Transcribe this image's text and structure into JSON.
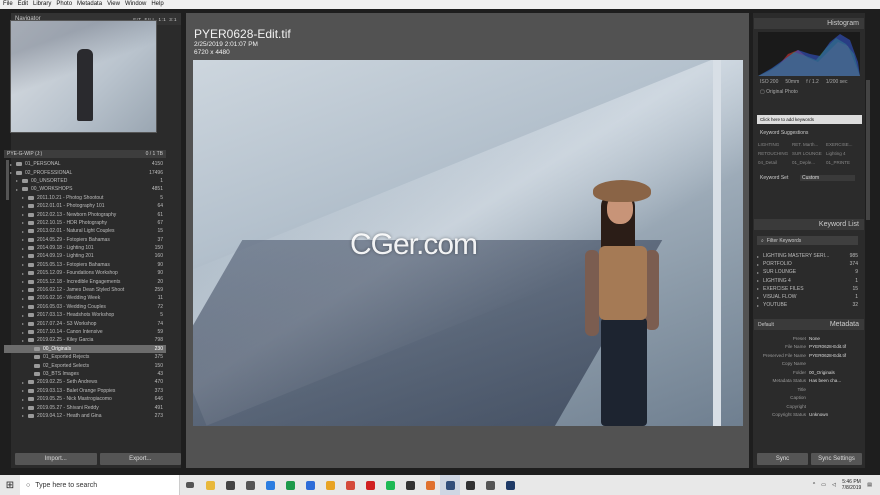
{
  "menu": [
    "File",
    "Edit",
    "Library",
    "Photo",
    "Metadata",
    "View",
    "Window",
    "Help"
  ],
  "navigator": {
    "title": "Navigator",
    "modes": [
      "FIT",
      "FILL",
      "1:1",
      "3:1"
    ]
  },
  "collections": {
    "header": "PYE-G-WIP (J:)",
    "header_count": "0 / 1 TB",
    "items": [
      {
        "name": "01_PERSONAL",
        "count": "4150",
        "indent": 1
      },
      {
        "name": "02_PROFESSIONAL",
        "count": "17496",
        "indent": 1
      },
      {
        "name": "00_UNSORTED",
        "count": "1",
        "indent": 2
      },
      {
        "name": "00_WORKSHOPS",
        "count": "4851",
        "indent": 2
      },
      {
        "name": "2011.10.21 - Photog Shootout",
        "count": "5",
        "indent": 3
      },
      {
        "name": "2012.01.01 - Photography 101",
        "count": "64",
        "indent": 3
      },
      {
        "name": "2012.02.13 - Newborn Photography",
        "count": "61",
        "indent": 3
      },
      {
        "name": "2012.10.15 - HDR Photography",
        "count": "67",
        "indent": 3
      },
      {
        "name": "2013.02.01 - Natural Light Couples",
        "count": "15",
        "indent": 3
      },
      {
        "name": "2014.05.29 - Fotopiers Bahamas",
        "count": "37",
        "indent": 3
      },
      {
        "name": "2014.09.18 - Lighting 101",
        "count": "150",
        "indent": 3
      },
      {
        "name": "2014.09.19 - Lighting 201",
        "count": "160",
        "indent": 3
      },
      {
        "name": "2015.05.13 - Fotopiers Bahamas",
        "count": "90",
        "indent": 3
      },
      {
        "name": "2015.12.09 - Foundations Workshop",
        "count": "90",
        "indent": 3
      },
      {
        "name": "2015.12.18 - Incredible Engagements",
        "count": "20",
        "indent": 3
      },
      {
        "name": "2016.02.12 - James Dean Styled Shoot",
        "count": "259",
        "indent": 3
      },
      {
        "name": "2016.02.16 - Wedding Week",
        "count": "11",
        "indent": 3
      },
      {
        "name": "2016.05.03 - Wedding Couples",
        "count": "72",
        "indent": 3
      },
      {
        "name": "2017.03.13 - Headshots Workshop",
        "count": "5",
        "indent": 3
      },
      {
        "name": "2017.07.24 - S3 Workshop",
        "count": "74",
        "indent": 3
      },
      {
        "name": "2017.10.14 - Canon Intensive",
        "count": "59",
        "indent": 3
      },
      {
        "name": "2019.02.25 - Kiley Garcia",
        "count": "798",
        "indent": 3
      },
      {
        "name": "00_Originals",
        "count": "230",
        "indent": 4,
        "selected": true
      },
      {
        "name": "01_Exported Rejects",
        "count": "375",
        "indent": 4
      },
      {
        "name": "02_Exported Selects",
        "count": "150",
        "indent": 4
      },
      {
        "name": "03_BTS Images",
        "count": "43",
        "indent": 4
      },
      {
        "name": "2019.02.25 - Seth Andrews",
        "count": "470",
        "indent": 3
      },
      {
        "name": "2019.03.13 - Balet Orange Poppies",
        "count": "373",
        "indent": 3
      },
      {
        "name": "2019.05.25 - Nick Mastrogiacomo",
        "count": "646",
        "indent": 3
      },
      {
        "name": "2019.05.27 - Shivani Reddy",
        "count": "491",
        "indent": 3
      },
      {
        "name": "2019.04.12 - Heath and Gina",
        "count": "273",
        "indent": 3
      }
    ]
  },
  "left_buttons": {
    "import": "Import...",
    "export": "Export..."
  },
  "photo_info": {
    "filename": "PYER0628-Edit.tif",
    "datetime": "2/25/2019 2:01:07 PM",
    "dimensions": "6720 x 4480"
  },
  "watermark": "CGer.com",
  "histogram": {
    "title": "Histogram",
    "stats": [
      "ISO 200",
      "50mm",
      "f / 1.2",
      "1/200 sec"
    ],
    "original": "Original Photo"
  },
  "keywording": {
    "placeholder": "Click here to add keywords",
    "suggestions_title": "Keyword Suggestions",
    "suggestions": [
      "LIGHTING",
      "RET. Marth...",
      "EXERCISE...",
      "RETOUCHING",
      "SUR LOUNGE",
      "Lighting 4",
      "04_Detail",
      "01_Deple...",
      "01_PRINTE"
    ],
    "set_label": "Keyword Set",
    "set_value": "Custom"
  },
  "keyword_list": {
    "title": "Keyword List",
    "filter": "Filter Keywords",
    "items": [
      {
        "name": "LIGHTING MASTERY SERI...",
        "count": "985"
      },
      {
        "name": "PORTFOLIO",
        "count": "374"
      },
      {
        "name": "SUR LOUNGE",
        "count": "9"
      },
      {
        "name": "LIGHTING 4",
        "count": "1"
      },
      {
        "name": "EXERCISE FILES",
        "count": "15"
      },
      {
        "name": "VISUAL FLOW",
        "count": "1"
      },
      {
        "name": "YOUTUBE",
        "count": "32"
      }
    ]
  },
  "metadata": {
    "title": "Metadata",
    "preset_left": "Default",
    "preset_label": "Preset",
    "preset_value": "None",
    "fields": [
      {
        "k": "File Name",
        "v": "PYER0628-Edit.tif"
      },
      {
        "k": "Preserved File Name",
        "v": "PYER0628-Edit.tif"
      },
      {
        "k": "Copy Name",
        "v": ""
      },
      {
        "k": "Folder",
        "v": "00_Originals"
      },
      {
        "k": "Metadata Status",
        "v": "Has been cha..."
      },
      {
        "k": "Title",
        "v": ""
      },
      {
        "k": "Caption",
        "v": ""
      },
      {
        "k": "Copyright",
        "v": ""
      },
      {
        "k": "Copyright Status",
        "v": "Unknown"
      }
    ]
  },
  "right_buttons": {
    "sync": "Sync",
    "sync_settings": "Sync Settings"
  },
  "taskbar": {
    "search": "Type here to search",
    "time": "5:46 PM",
    "date": "7/8/2019",
    "icons": [
      {
        "name": "file-explorer-icon",
        "color": "#e8b83a"
      },
      {
        "name": "store-icon",
        "color": "#444"
      },
      {
        "name": "mail-icon",
        "color": "#555"
      },
      {
        "name": "chrome-icon",
        "color": "#2b7de0"
      },
      {
        "name": "sheets-icon",
        "color": "#1d9a4b"
      },
      {
        "name": "docs-icon",
        "color": "#2d6cd8"
      },
      {
        "name": "slides-icon",
        "color": "#e8a323"
      },
      {
        "name": "chrome-profile-icon",
        "color": "#d44a3a"
      },
      {
        "name": "record-icon",
        "color": "#d02020"
      },
      {
        "name": "spotify-icon",
        "color": "#1db954"
      },
      {
        "name": "app-icon",
        "color": "#333"
      },
      {
        "name": "browser-icon",
        "color": "#e0712d"
      },
      {
        "name": "lightroom-icon",
        "color": "#314d7a"
      },
      {
        "name": "video-icon",
        "color": "#333"
      },
      {
        "name": "files-icon",
        "color": "#555"
      },
      {
        "name": "photoshop-icon",
        "color": "#1f3a66"
      }
    ]
  }
}
